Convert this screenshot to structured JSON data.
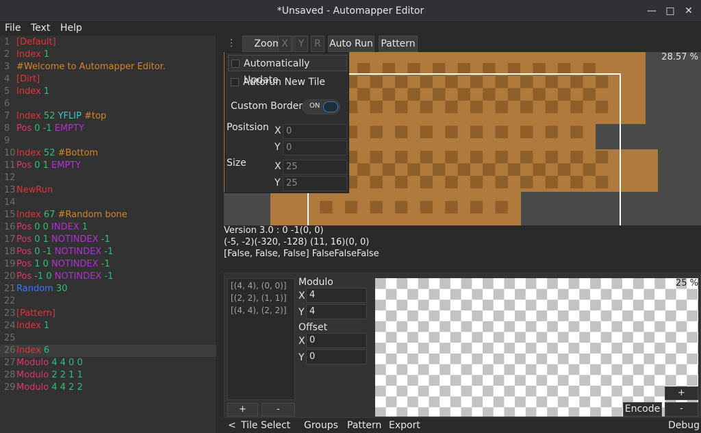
{
  "window": {
    "title": "*Unsaved - Automapper Editor",
    "minimize_glyph": "—",
    "maximize_glyph": "□",
    "close_glyph": "✕"
  },
  "menu": {
    "file": "File",
    "text": "Text",
    "help": "Help"
  },
  "editor": {
    "lines": [
      {
        "n": "1",
        "tokens": [
          {
            "t": "[Default]",
            "c": "red"
          }
        ]
      },
      {
        "n": "2",
        "tokens": [
          {
            "t": "Index",
            "c": "red"
          },
          {
            "t": " 1",
            "c": "grn"
          }
        ]
      },
      {
        "n": "3",
        "tokens": [
          {
            "t": "#Welcome to Automapper Editor.",
            "c": "org"
          }
        ]
      },
      {
        "n": "4",
        "tokens": [
          {
            "t": "[Dirt]",
            "c": "red"
          }
        ]
      },
      {
        "n": "5",
        "tokens": [
          {
            "t": "Index",
            "c": "red"
          },
          {
            "t": " 1",
            "c": "grn"
          }
        ]
      },
      {
        "n": "6",
        "tokens": []
      },
      {
        "n": "7",
        "tokens": [
          {
            "t": "Index",
            "c": "red"
          },
          {
            "t": " 52",
            "c": "grn"
          },
          {
            "t": " YFLIP",
            "c": "cyn"
          },
          {
            "t": " #top",
            "c": "org"
          }
        ]
      },
      {
        "n": "8",
        "tokens": [
          {
            "t": "Pos",
            "c": "pnk"
          },
          {
            "t": " 0 -1",
            "c": "grn"
          },
          {
            "t": " EMPTY",
            "c": "pur"
          }
        ]
      },
      {
        "n": "9",
        "tokens": []
      },
      {
        "n": "10",
        "tokens": [
          {
            "t": "Index",
            "c": "red"
          },
          {
            "t": " 52",
            "c": "grn"
          },
          {
            "t": " #Bottom",
            "c": "org"
          }
        ]
      },
      {
        "n": "11",
        "tokens": [
          {
            "t": "Pos",
            "c": "pnk"
          },
          {
            "t": " 0 1",
            "c": "grn"
          },
          {
            "t": " EMPTY",
            "c": "pur"
          }
        ]
      },
      {
        "n": "12",
        "tokens": []
      },
      {
        "n": "13",
        "tokens": [
          {
            "t": "NewRun",
            "c": "red"
          }
        ]
      },
      {
        "n": "14",
        "tokens": []
      },
      {
        "n": "15",
        "tokens": [
          {
            "t": "Index",
            "c": "red"
          },
          {
            "t": " 67",
            "c": "grn"
          },
          {
            "t": " #Random bone",
            "c": "org"
          }
        ]
      },
      {
        "n": "16",
        "tokens": [
          {
            "t": "Pos",
            "c": "pnk"
          },
          {
            "t": " 0 0",
            "c": "grn"
          },
          {
            "t": " INDEX",
            "c": "pur"
          },
          {
            "t": " 1",
            "c": "grn"
          }
        ]
      },
      {
        "n": "17",
        "tokens": [
          {
            "t": "Pos",
            "c": "pnk"
          },
          {
            "t": " 0 1",
            "c": "grn"
          },
          {
            "t": " NOTINDEX",
            "c": "pur"
          },
          {
            "t": " -1",
            "c": "grn"
          }
        ]
      },
      {
        "n": "18",
        "tokens": [
          {
            "t": "Pos",
            "c": "pnk"
          },
          {
            "t": " 0 -1",
            "c": "grn"
          },
          {
            "t": " NOTINDEX",
            "c": "pur"
          },
          {
            "t": " -1",
            "c": "grn"
          }
        ]
      },
      {
        "n": "19",
        "tokens": [
          {
            "t": "Pos",
            "c": "pnk"
          },
          {
            "t": " 1 0",
            "c": "grn"
          },
          {
            "t": " NOTINDEX",
            "c": "pur"
          },
          {
            "t": " -1",
            "c": "grn"
          }
        ]
      },
      {
        "n": "20",
        "tokens": [
          {
            "t": "Pos",
            "c": "pnk"
          },
          {
            "t": " -1 0",
            "c": "grn"
          },
          {
            "t": " NOTINDEX",
            "c": "pur"
          },
          {
            "t": " -1",
            "c": "grn"
          }
        ]
      },
      {
        "n": "21",
        "tokens": [
          {
            "t": "Random",
            "c": "blu"
          },
          {
            "t": " 30",
            "c": "grn"
          }
        ]
      },
      {
        "n": "22",
        "tokens": []
      },
      {
        "n": "23",
        "tokens": [
          {
            "t": "[Pattern]",
            "c": "red"
          }
        ]
      },
      {
        "n": "24",
        "tokens": [
          {
            "t": "Index",
            "c": "red"
          },
          {
            "t": " 1",
            "c": "grn"
          }
        ]
      },
      {
        "n": "25",
        "tokens": []
      },
      {
        "n": "26",
        "tokens": [
          {
            "t": "Index",
            "c": "red"
          },
          {
            "t": " 6",
            "c": "grn"
          }
        ],
        "highlight": true
      },
      {
        "n": "27",
        "tokens": [
          {
            "t": "Modulo",
            "c": "pnk"
          },
          {
            "t": " 4 4 0 0",
            "c": "grn"
          }
        ]
      },
      {
        "n": "28",
        "tokens": [
          {
            "t": "Modulo",
            "c": "pnk"
          },
          {
            "t": " 2 2 1 1",
            "c": "grn"
          }
        ]
      },
      {
        "n": "29",
        "tokens": [
          {
            "t": "Modulo",
            "c": "pnk"
          },
          {
            "t": " 4 4 2 2",
            "c": "grn"
          }
        ]
      }
    ]
  },
  "toolbar": {
    "zoom": "Zoom",
    "x": "X",
    "y": "Y",
    "r": "R",
    "auto_run": "Auto Run",
    "pattern": "Pattern"
  },
  "preview": {
    "zoom": "28.57 %"
  },
  "popup": {
    "auto_update": "Automatically Update",
    "autorun_new_tile": "Autorun New Tile",
    "custom_border": "Custom Border",
    "toggle_state": "ON",
    "position_label": "Positsion",
    "size_label": "Size",
    "x_label": "X",
    "y_label": "Y",
    "pos_x": "0",
    "pos_y": "0",
    "size_x": "25",
    "size_y": "25"
  },
  "info": {
    "line1": "Version 3.0 : 0 -1(0, 0)",
    "line2": "(-5, -2)(-320, -128) (11, 16)(0, 0)",
    "line3": "[False, False, False] FalseFalseFalse"
  },
  "pattern_panel": {
    "rules": [
      "[(4, 4), (0, 0)]",
      "[(2, 2), (1, 1)]",
      "[(4, 4), (2, 2)]"
    ],
    "add": "+",
    "remove": "-",
    "modulo_label": "Modulo",
    "offset_label": "Offset",
    "x_label": "X",
    "y_label": "Y",
    "modulo_x": "4",
    "modulo_y": "4",
    "offset_x": "0",
    "offset_y": "0",
    "zoom": "25 %",
    "plus": "+",
    "minus": "-",
    "encode": "Encode"
  },
  "statusbar": {
    "back": "<",
    "tile_select": "Tile Select",
    "groups": "Groups",
    "pattern": "Pattern",
    "export": "Export",
    "debug": "Debug"
  },
  "colors": {
    "dirt": "#b07a3c",
    "dirt_dark": "#8f5f2a",
    "grid_bg": "#4a4a4a",
    "checker_light": "#ffffff",
    "checker_dark": "#c3c3c3"
  }
}
